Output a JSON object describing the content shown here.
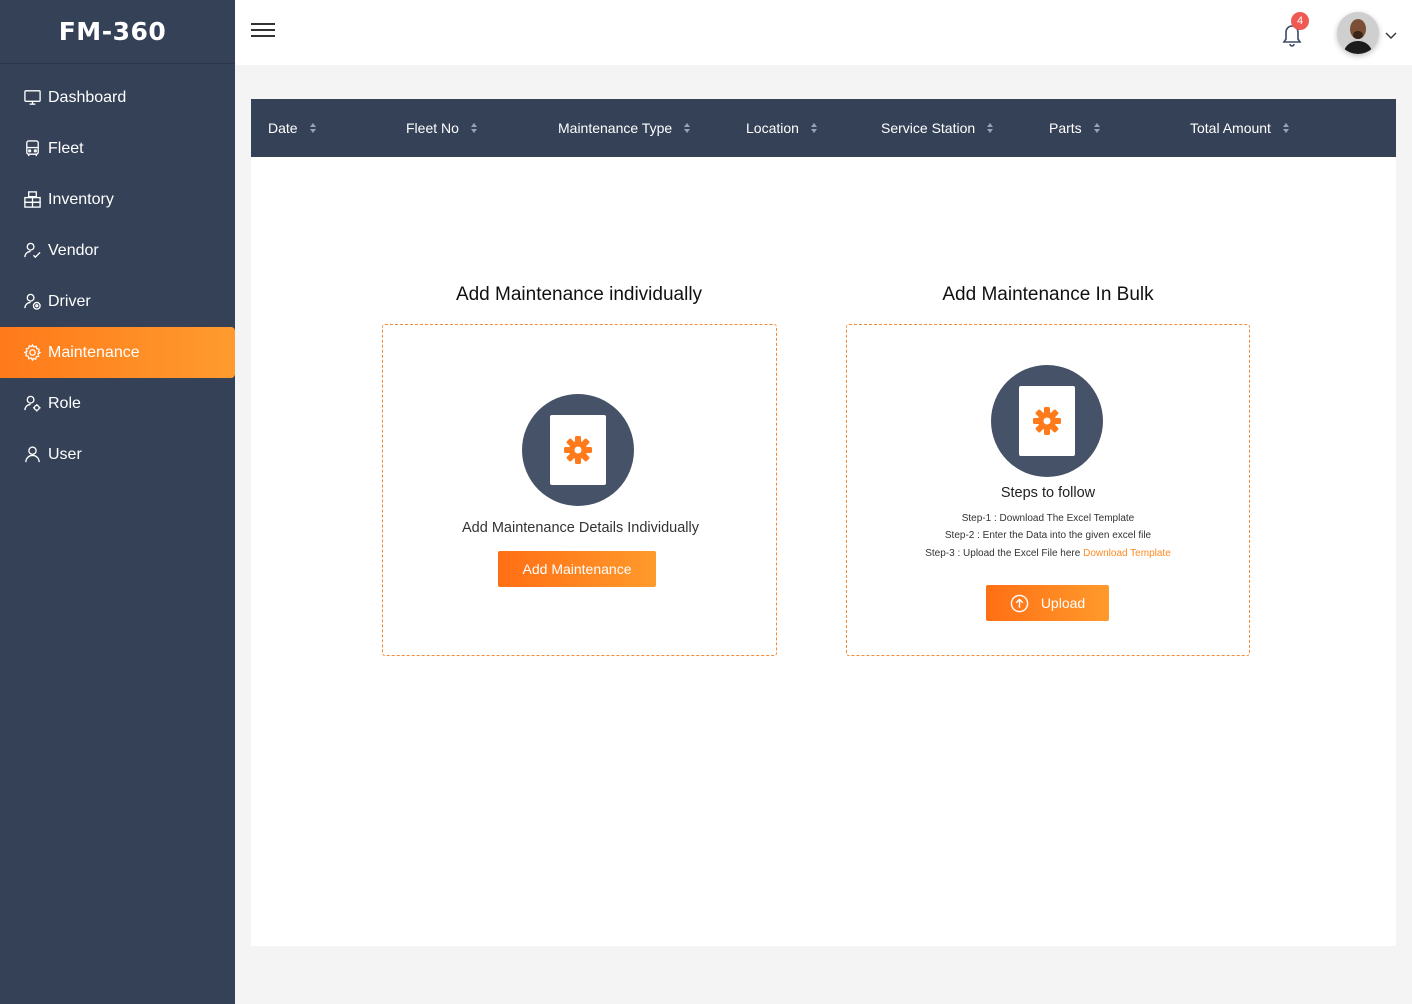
{
  "brand": {
    "name": "FM-360"
  },
  "sidebar": {
    "items": [
      {
        "label": "Dashboard",
        "icon": "monitor-icon"
      },
      {
        "label": "Fleet",
        "icon": "bus-icon"
      },
      {
        "label": "Inventory",
        "icon": "boxes-icon"
      },
      {
        "label": "Vendor",
        "icon": "vendor-icon"
      },
      {
        "label": "Driver",
        "icon": "driver-icon"
      },
      {
        "label": "Maintenance",
        "icon": "gear-icon",
        "active": true
      },
      {
        "label": "Role",
        "icon": "role-icon"
      },
      {
        "label": "User",
        "icon": "user-icon"
      }
    ]
  },
  "header": {
    "notifications": "4"
  },
  "table": {
    "columns": [
      "Date",
      "Fleet No",
      "Maintenance Type",
      "Location",
      "Service Station",
      "Parts",
      "Total Amount"
    ]
  },
  "individual": {
    "title": "Add Maintenance individually",
    "description": "Add Maintenance Details Individually",
    "button": "Add Maintenance"
  },
  "bulk": {
    "title": "Add Maintenance In Bulk",
    "steps_title": "Steps to follow",
    "step1": "Step-1 : Download The Excel Template",
    "step2": "Step-2 : Enter the Data into the given excel file",
    "step3": "Step-3 : Upload the Excel File here",
    "download_link": "Download Template",
    "button": "Upload"
  },
  "colors": {
    "sidebar": "#344157",
    "accent": "#ff7a1a",
    "badge": "#ee5a52"
  }
}
